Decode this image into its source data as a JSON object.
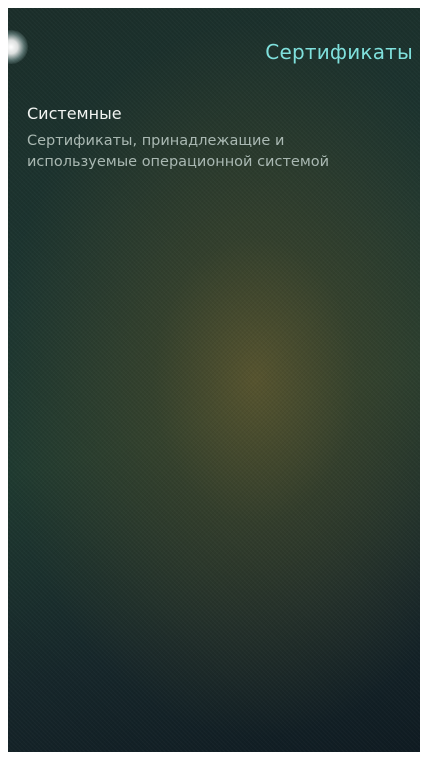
{
  "header": {
    "title": "Сертификаты"
  },
  "list": {
    "items": [
      {
        "title": "Системные",
        "description_line1": "Сертификаты, принадлежащие и",
        "description_line2": "используемые операционной системой"
      }
    ]
  },
  "colors": {
    "accent": "#7fe0dc",
    "primary_text": "#f2f5f2",
    "secondary_text": "#a9b8b2"
  }
}
